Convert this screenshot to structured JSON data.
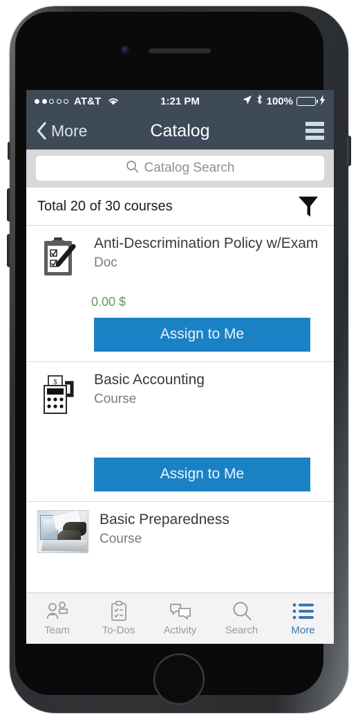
{
  "device": {
    "name": "iphone-frame"
  },
  "status_bar": {
    "signal_dots_filled": 2,
    "signal_dots_total": 5,
    "carrier": "AT&T",
    "wifi_icon": "wifi-icon",
    "time": "1:21 PM",
    "location_icon": "location-arrow-icon",
    "bluetooth_icon": "bluetooth-icon",
    "battery_percent": "100%",
    "battery_level": 100,
    "charging": true,
    "background_color": "#3e4a58",
    "text_color": "#ffffff"
  },
  "nav_bar": {
    "back_label": "More",
    "back_icon": "chevron-left-icon",
    "title": "Catalog",
    "menu_icon": "hamburger-menu-icon",
    "background_color": "#3e4a58"
  },
  "search": {
    "placeholder": "Catalog Search",
    "value": "",
    "icon": "search-icon"
  },
  "summary": {
    "total_text": "Total 20 of 30 courses",
    "shown": 20,
    "total": 30,
    "filter_icon": "filter-funnel-icon"
  },
  "courses": [
    {
      "title": "Anti-Descrimination Policy w/Exam",
      "type": "Doc",
      "price": "0.00 $",
      "price_color": "#5b9a59",
      "icon": "clipboard-exam-icon",
      "action_label": "Assign to Me",
      "has_action": true,
      "has_price": true
    },
    {
      "title": "Basic Accounting",
      "type": "Course",
      "price": "",
      "icon": "calculator-money-icon",
      "action_label": "Assign to Me",
      "has_action": true,
      "has_price": false
    },
    {
      "title": "Basic Preparedness",
      "type": "Course",
      "price": "",
      "icon": "keyboard-photo-thumbnail",
      "action_label": "",
      "has_action": false,
      "has_price": false
    }
  ],
  "tab_bar": {
    "active_color": "#3a76ad",
    "inactive_color": "#9a9a9f",
    "items": [
      {
        "label": "Team",
        "icon": "team-people-icon",
        "active": false
      },
      {
        "label": "To-Dos",
        "icon": "clipboard-check-icon",
        "active": false
      },
      {
        "label": "Activity",
        "icon": "chat-bubbles-icon",
        "active": false
      },
      {
        "label": "Search",
        "icon": "search-icon",
        "active": false
      },
      {
        "label": "More",
        "icon": "list-bullet-icon",
        "active": true
      }
    ]
  },
  "theme": {
    "accent_blue": "#1b81c5",
    "nav_dark": "#3e4a58",
    "search_bg": "#d8d8d8"
  }
}
